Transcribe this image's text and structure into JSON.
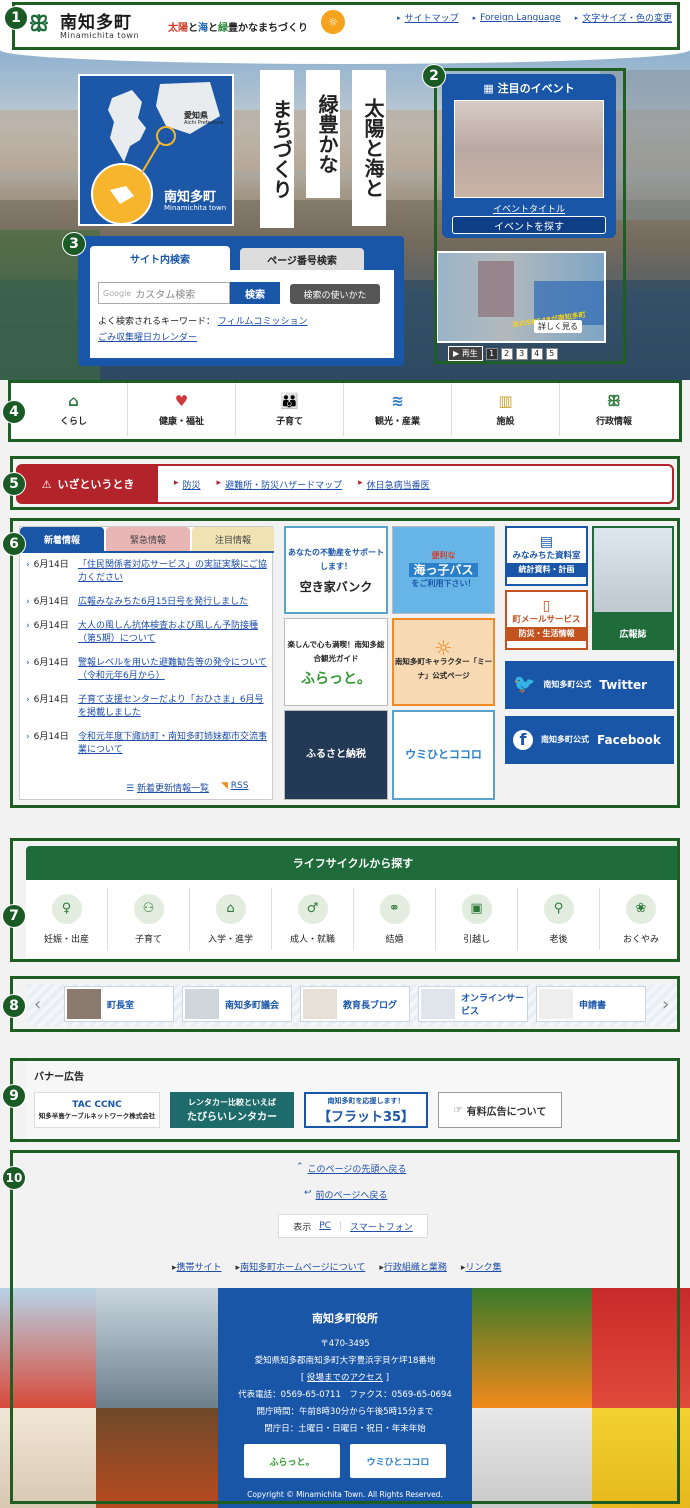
{
  "header": {
    "logo_jp": "南知多町",
    "logo_en": "Minamichita town",
    "slogan_r1": "太陽",
    "slogan_t1": "と",
    "slogan_b": "海",
    "slogan_t2": "と",
    "slogan_g": "緑",
    "slogan_t3": "豊かなまちづくり",
    "links": [
      "サイトマップ",
      "Foreign Language",
      "文字サイズ・色の変更"
    ]
  },
  "hero": {
    "map_pref": "愛知県",
    "map_pref_en": "Aichi Prefecture",
    "map_title": "南知多町",
    "map_title_en": "Minamichita town",
    "slogan_col1": "太陽と海と",
    "slogan_col2": "緑豊かな",
    "slogan_col3": "まちづくり",
    "event_title": "注目のイベント",
    "event_link": "イベントタイトル",
    "event_button": "イベントを探す",
    "slide_text": "あのSKE48が南知多町",
    "slide_button": "詳しく見る",
    "pager_play": "再生",
    "pager_pages": [
      "1",
      "2",
      "3",
      "4",
      "5"
    ]
  },
  "search": {
    "tab_site": "サイト内検索",
    "tab_page": "ページ番号検索",
    "google_label": "Google",
    "placeholder": "カスタム検索",
    "submit": "検索",
    "help": "検索の使いかた",
    "kw_label": "よく検索されるキーワード：",
    "kw1": "フィルムコミッション",
    "kw2": "ごみ収集曜日カレンダー"
  },
  "nav": {
    "items": [
      "くらし",
      "健康・福祉",
      "子育て",
      "観光・産業",
      "施設",
      "行政情報"
    ]
  },
  "emergency": {
    "title": "いざというとき",
    "links": [
      "防災",
      "避難所・防災ハザードマップ",
      "休日急病当番医"
    ]
  },
  "news": {
    "tabs": [
      "新着情報",
      "緊急情報",
      "注目情報"
    ],
    "items": [
      {
        "date": "6月14日",
        "title": "「住民関係者対応サービス」の実証実験にご協力ください"
      },
      {
        "date": "6月14日",
        "title": "広報みなみちた6月15日号を発行しました"
      },
      {
        "date": "6月14日",
        "title": "大人の風しん抗体検査および風しん予防接種（第5期）について"
      },
      {
        "date": "6月14日",
        "title": "警報レベルを用いた避難勧告等の発令について（令和元年6月から）"
      },
      {
        "date": "6月14日",
        "title": "子育て支援センターだより「おひさま」6月号を掲載しました"
      },
      {
        "date": "6月14日",
        "title": "令和元年度下諏訪町・南知多町姉妹都市交流事業について"
      }
    ],
    "list_link": "新着更新情報一覧",
    "rss": "RSS"
  },
  "banners": {
    "akiya_top": "あなたの不動産をサポートします！",
    "akiya_main": "空き家バンク",
    "bus_top": "便利な",
    "bus_main": "海っ子バス",
    "bus_sub": "をご利用下さい！",
    "furatto_top": "楽しんで心も満喫！南知多総合観光ガイド",
    "furatto_main": "ふらっと。",
    "mina": "南知多町キャラクター「ミーナ」公式ページ",
    "furusato": "ふるさと納税",
    "umihito": "ウミひとココロ",
    "shiryo_title": "みなみちた資料室",
    "shiryo_sub": "統計資料・計画",
    "mail_title": "町メールサービス",
    "mail_sub": "防災・生活情報",
    "kohoshi": "広報誌",
    "twitter_label": "南知多町公式",
    "twitter": "Twitter",
    "facebook_label": "南知多町公式",
    "facebook": "Facebook"
  },
  "life": {
    "title": "ライフサイクルから探す",
    "items": [
      "妊娠・出産",
      "子育て",
      "入学・進学",
      "成人・就職",
      "結婚",
      "引越し",
      "老後",
      "おくやみ"
    ]
  },
  "carousel": {
    "items": [
      "町長室",
      "南知多町議会",
      "教育長ブログ",
      "オンラインサービス",
      "申請書"
    ]
  },
  "ads": {
    "title": "バナー広告",
    "ad1_top": "TAC CCNC",
    "ad1": "知多半島ケーブルネットワーク株式会社",
    "ad2_top": "レンタカー比較といえば",
    "ad2": "たびらいレンタカー",
    "ad3_top": "南知多町を応援します！",
    "ad3": "【フラット35】",
    "ad4": "有料広告について"
  },
  "footer": {
    "page_top": "このページの先頭へ戻る",
    "back": "前のページへ戻る",
    "display_label": "表示",
    "pc": "PC",
    "smart": "スマートフォン",
    "links": [
      "携帯サイト",
      "南知多町ホームページについて",
      "行政組織と業務",
      "リンク集"
    ],
    "office": "南知多町役所",
    "postal": "〒470-3495",
    "address": "愛知県知多郡南知多町大字豊浜字貝ケ坪18番地",
    "access": "役場までのアクセス",
    "phone": "代表電話：0569-65-0711　ファクス：0569-65-0694",
    "hours": "開庁時間：午前8時30分から午後5時15分まで",
    "closed": "閉庁日：土曜日・日曜日・祝日・年末年始",
    "btn1": "ふらっと。",
    "btn2": "ウミひとココロ",
    "copyright": "Copyright © Minamichita Town. All Rights Reserved."
  },
  "markers": [
    "1",
    "2",
    "3",
    "4",
    "5",
    "6",
    "7",
    "8",
    "9",
    "10"
  ]
}
